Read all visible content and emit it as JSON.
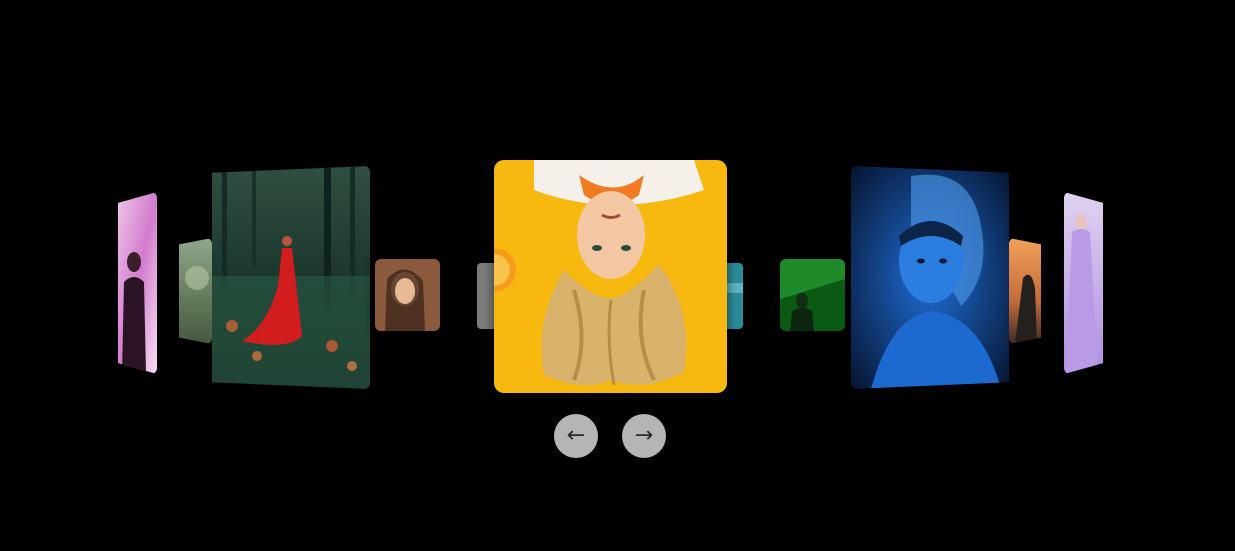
{
  "carousel": {
    "prev_button": {
      "label": "←"
    },
    "next_button": {
      "label": "→"
    }
  },
  "colors": {
    "background": "#000000",
    "button_bg": "#b5b5b5",
    "button_fg": "#2a2a2a"
  }
}
